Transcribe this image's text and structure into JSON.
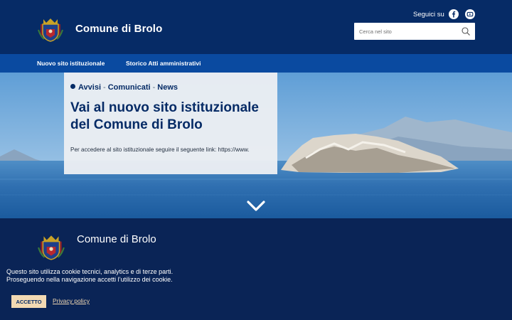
{
  "header": {
    "site_title": "Comune di Brolo",
    "social_label": "Seguici su",
    "social_icons": [
      "facebook-icon",
      "youtube-icon"
    ],
    "search_placeholder": "Cerca nel sito"
  },
  "nav": {
    "items": [
      {
        "label": "Nuovo sito istituzionale"
      },
      {
        "label": "Storico Atti amministrativi"
      }
    ]
  },
  "hero": {
    "categories": [
      "Avvisi",
      "Comunicati",
      "News"
    ],
    "separator": "-",
    "title": "Vai al nuovo sito istituzionale del Comune di Brolo",
    "text": "Per accedere al sito istituzionale seguire il seguente link: https://www."
  },
  "footer": {
    "site_title": "Comune di Brolo"
  },
  "cookie": {
    "line1": "Questo sito utilizza cookie tecnici, analytics e di terze parti.",
    "line2": "Proseguendo nella navigazione accetti l’utilizzo dei cookie.",
    "accept_label": "ACCETTO",
    "policy_label": "Privacy policy"
  },
  "colors": {
    "header_bg": "#062b66",
    "nav_bg": "#0a4aa0",
    "footer_bg": "#0a2456",
    "accent": "#f2d9b3"
  }
}
